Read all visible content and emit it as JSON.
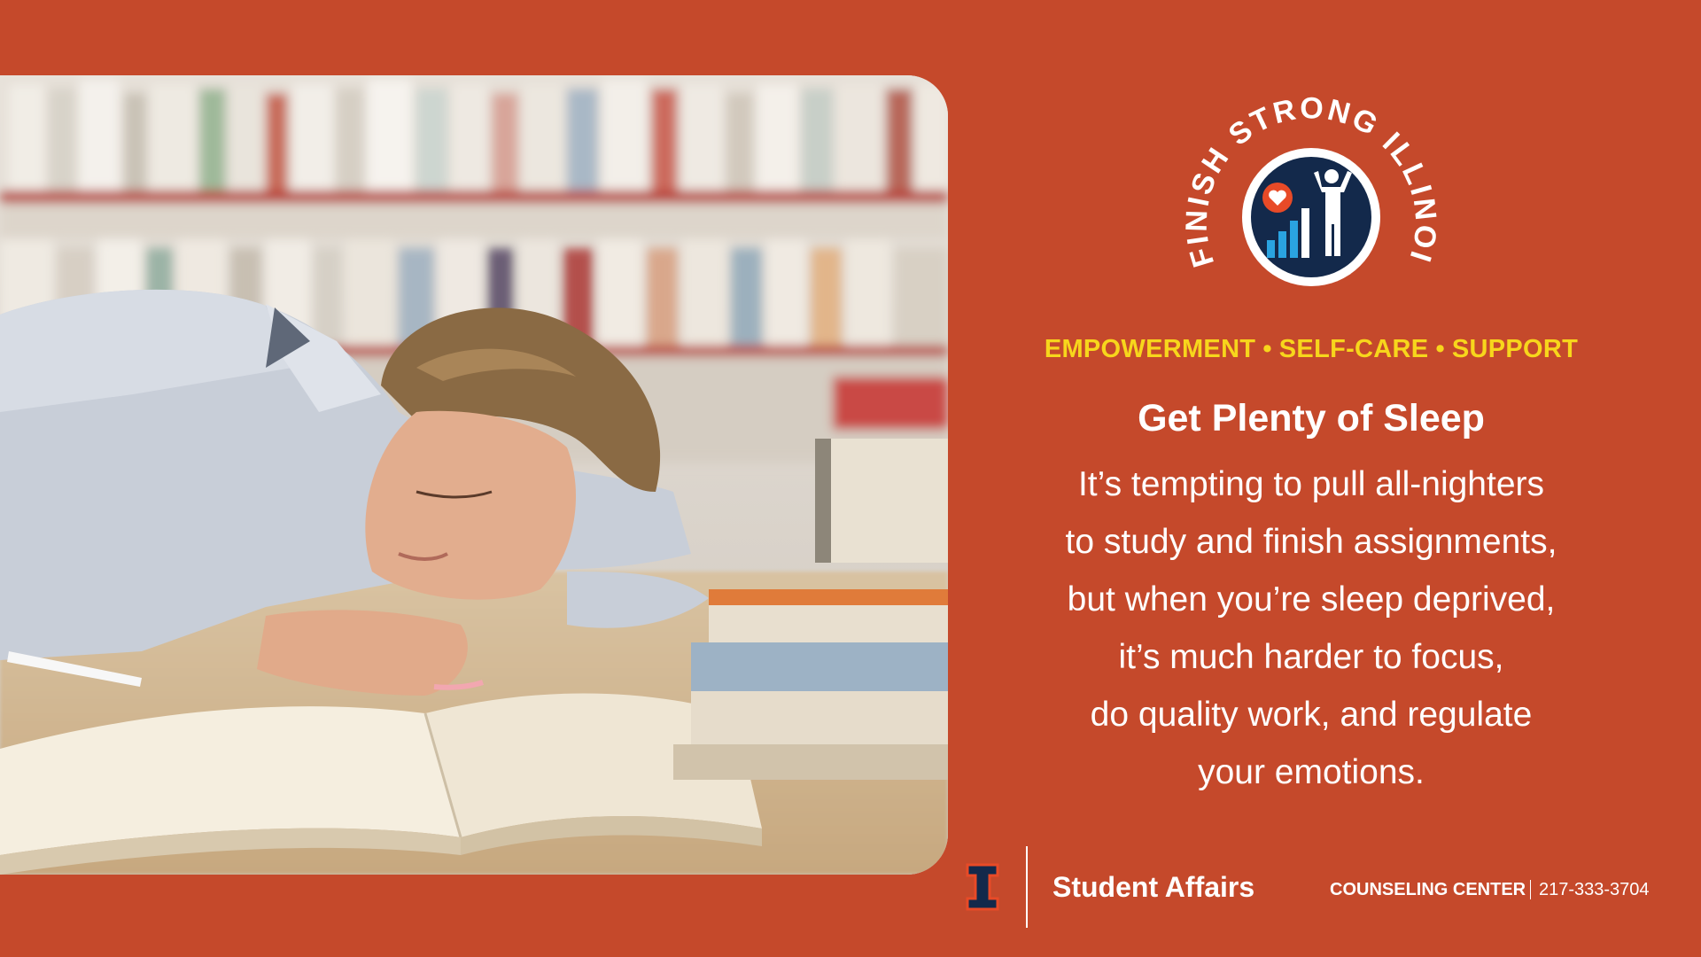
{
  "colors": {
    "background": "#c5492b",
    "accent_yellow": "#f7d61c",
    "logo_navy": "#13294b",
    "logo_blue": "#2aa3e0",
    "heart_orange": "#e84a27",
    "text_white": "#ffffff"
  },
  "photo": {
    "description_icon": "student-sleeping-on-books-photo"
  },
  "logo": {
    "ring_text": "#FINISH STRONG ILLINOIS",
    "icon": "heart-bar-chart-person-icon"
  },
  "tagline": {
    "items": [
      "EMPOWERMENT",
      "SELF-CARE",
      "SUPPORT"
    ],
    "separator": "•"
  },
  "headline": "Get Plenty of Sleep",
  "body_lines": [
    "It’s tempting to pull all-nighters",
    "to study and finish assignments,",
    "but when you’re sleep deprived,",
    "it’s much harder to focus,",
    "do quality work, and regulate",
    "your emotions."
  ],
  "footer": {
    "block_i_icon": "illinois-block-i-icon",
    "unit_name": "Student Affairs",
    "department": "COUNSELING CENTER",
    "phone": "217-333-3704"
  }
}
